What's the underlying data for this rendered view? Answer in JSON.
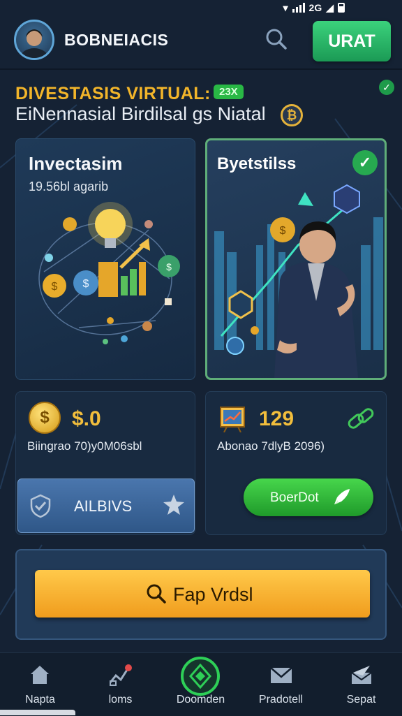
{
  "status_bar": {
    "network_label": "2G"
  },
  "header": {
    "brand": "BOBNEIACIS",
    "cta_label": "URAT"
  },
  "hero": {
    "title": "DIVESTASIS VIRTUAL:",
    "badge": "23X",
    "subtitle": "EiNennasial Birdilsal gs Niatal"
  },
  "cards": {
    "investment": {
      "title": "Invectasim",
      "subtitle": "19.56bl agarib"
    },
    "market": {
      "title": "Byetstilss"
    }
  },
  "stats": {
    "balance": {
      "value": "$.0",
      "label": "Biingrao 70)y0M06sbl",
      "button_label": "AILBIVS"
    },
    "growth": {
      "value": "129",
      "label": "Abonao 7dlyB 2096)",
      "button_label": "BoerDot"
    }
  },
  "primary_action": {
    "label": "Fap Vrdsl"
  },
  "nav": {
    "items": [
      {
        "label": "Napta",
        "icon": "home-icon"
      },
      {
        "label": "loms",
        "icon": "chart-icon"
      },
      {
        "label": "Doomden",
        "icon": "diamond-icon"
      },
      {
        "label": "Pradotell",
        "icon": "mail-icon"
      },
      {
        "label": "Sepat",
        "icon": "send-icon"
      }
    ]
  },
  "colors": {
    "accent_green": "#22b35a",
    "accent_gold": "#f2b52a",
    "background": "#152234"
  }
}
